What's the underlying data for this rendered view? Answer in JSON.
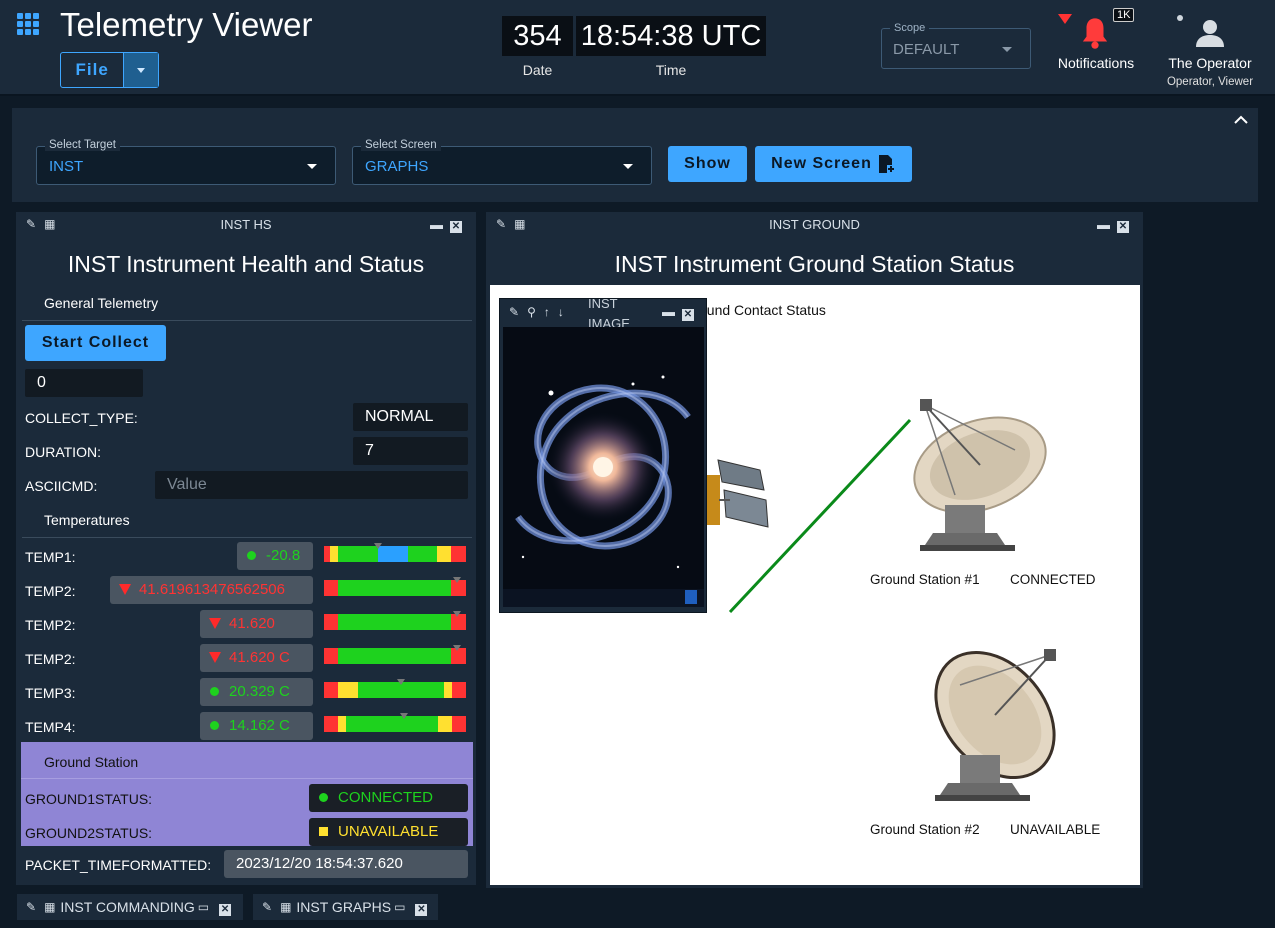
{
  "app": {
    "title": "Telemetry Viewer",
    "file_label": "File",
    "date_value": "354",
    "date_label": "Date",
    "time_value": "18:54:38 UTC",
    "time_label": "Time",
    "scope_legend": "Scope",
    "scope_value": "DEFAULT",
    "notifications_label": "Notifications",
    "notifications_count": "1K",
    "user_name": "The Operator",
    "user_role": "Operator, Viewer"
  },
  "selector": {
    "target_legend": "Select Target",
    "target_value": "INST",
    "screen_legend": "Select Screen",
    "screen_value": "GRAPHS",
    "show_label": "Show",
    "new_screen_label": "New Screen"
  },
  "hs": {
    "header": "INST HS",
    "title": "INST Instrument Health and Status",
    "general_section": "General Telemetry",
    "start_collect_label": "Start Collect",
    "collect_count": "0",
    "collect_type_label": "COLLECT_TYPE:",
    "collect_type_value": "NORMAL",
    "duration_label": "DURATION:",
    "duration_value": "7",
    "asciicmd_label": "ASCIICMD:",
    "asciicmd_placeholder": "Value",
    "temps_section": "Temperatures",
    "temps": [
      {
        "label": "TEMP1:",
        "value": "-20.8",
        "status": "green"
      },
      {
        "label": "TEMP2:",
        "value": "41.619613476562506",
        "status": "red"
      },
      {
        "label": "TEMP2:",
        "value": "41.620",
        "status": "red"
      },
      {
        "label": "TEMP2:",
        "value": "41.620 C",
        "status": "red"
      },
      {
        "label": "TEMP3:",
        "value": "20.329 C",
        "status": "green"
      },
      {
        "label": "TEMP4:",
        "value": "14.162 C",
        "status": "green"
      }
    ],
    "ground_section": "Ground Station",
    "ground1_label": "GROUND1STATUS:",
    "ground1_value": "CONNECTED",
    "ground2_label": "GROUND2STATUS:",
    "ground2_value": "UNAVAILABLE",
    "packet_time_label": "PACKET_TIMEFORMATTED:",
    "packet_time_value": "2023/12/20 18:54:37.620"
  },
  "ground": {
    "header": "INST GROUND",
    "title": "INST Instrument Ground Station Status",
    "contact_label": "ound Contact Status",
    "gs1_label": "Ground Station #1",
    "gs1_status": "CONNECTED",
    "gs2_label": "Ground Station #2",
    "gs2_status": "UNAVAILABLE"
  },
  "image_widget": {
    "header_line1": "INST",
    "header_line2": "IMAGE"
  },
  "minimized": {
    "commanding": "INST COMMANDING",
    "graphs": "INST GRAPHS"
  },
  "colors": {
    "accent": "#3ea6ff",
    "green": "#1ed21e",
    "red": "#ff3333",
    "yellow": "#ffe030",
    "ground_bg": "#8f85d5"
  }
}
